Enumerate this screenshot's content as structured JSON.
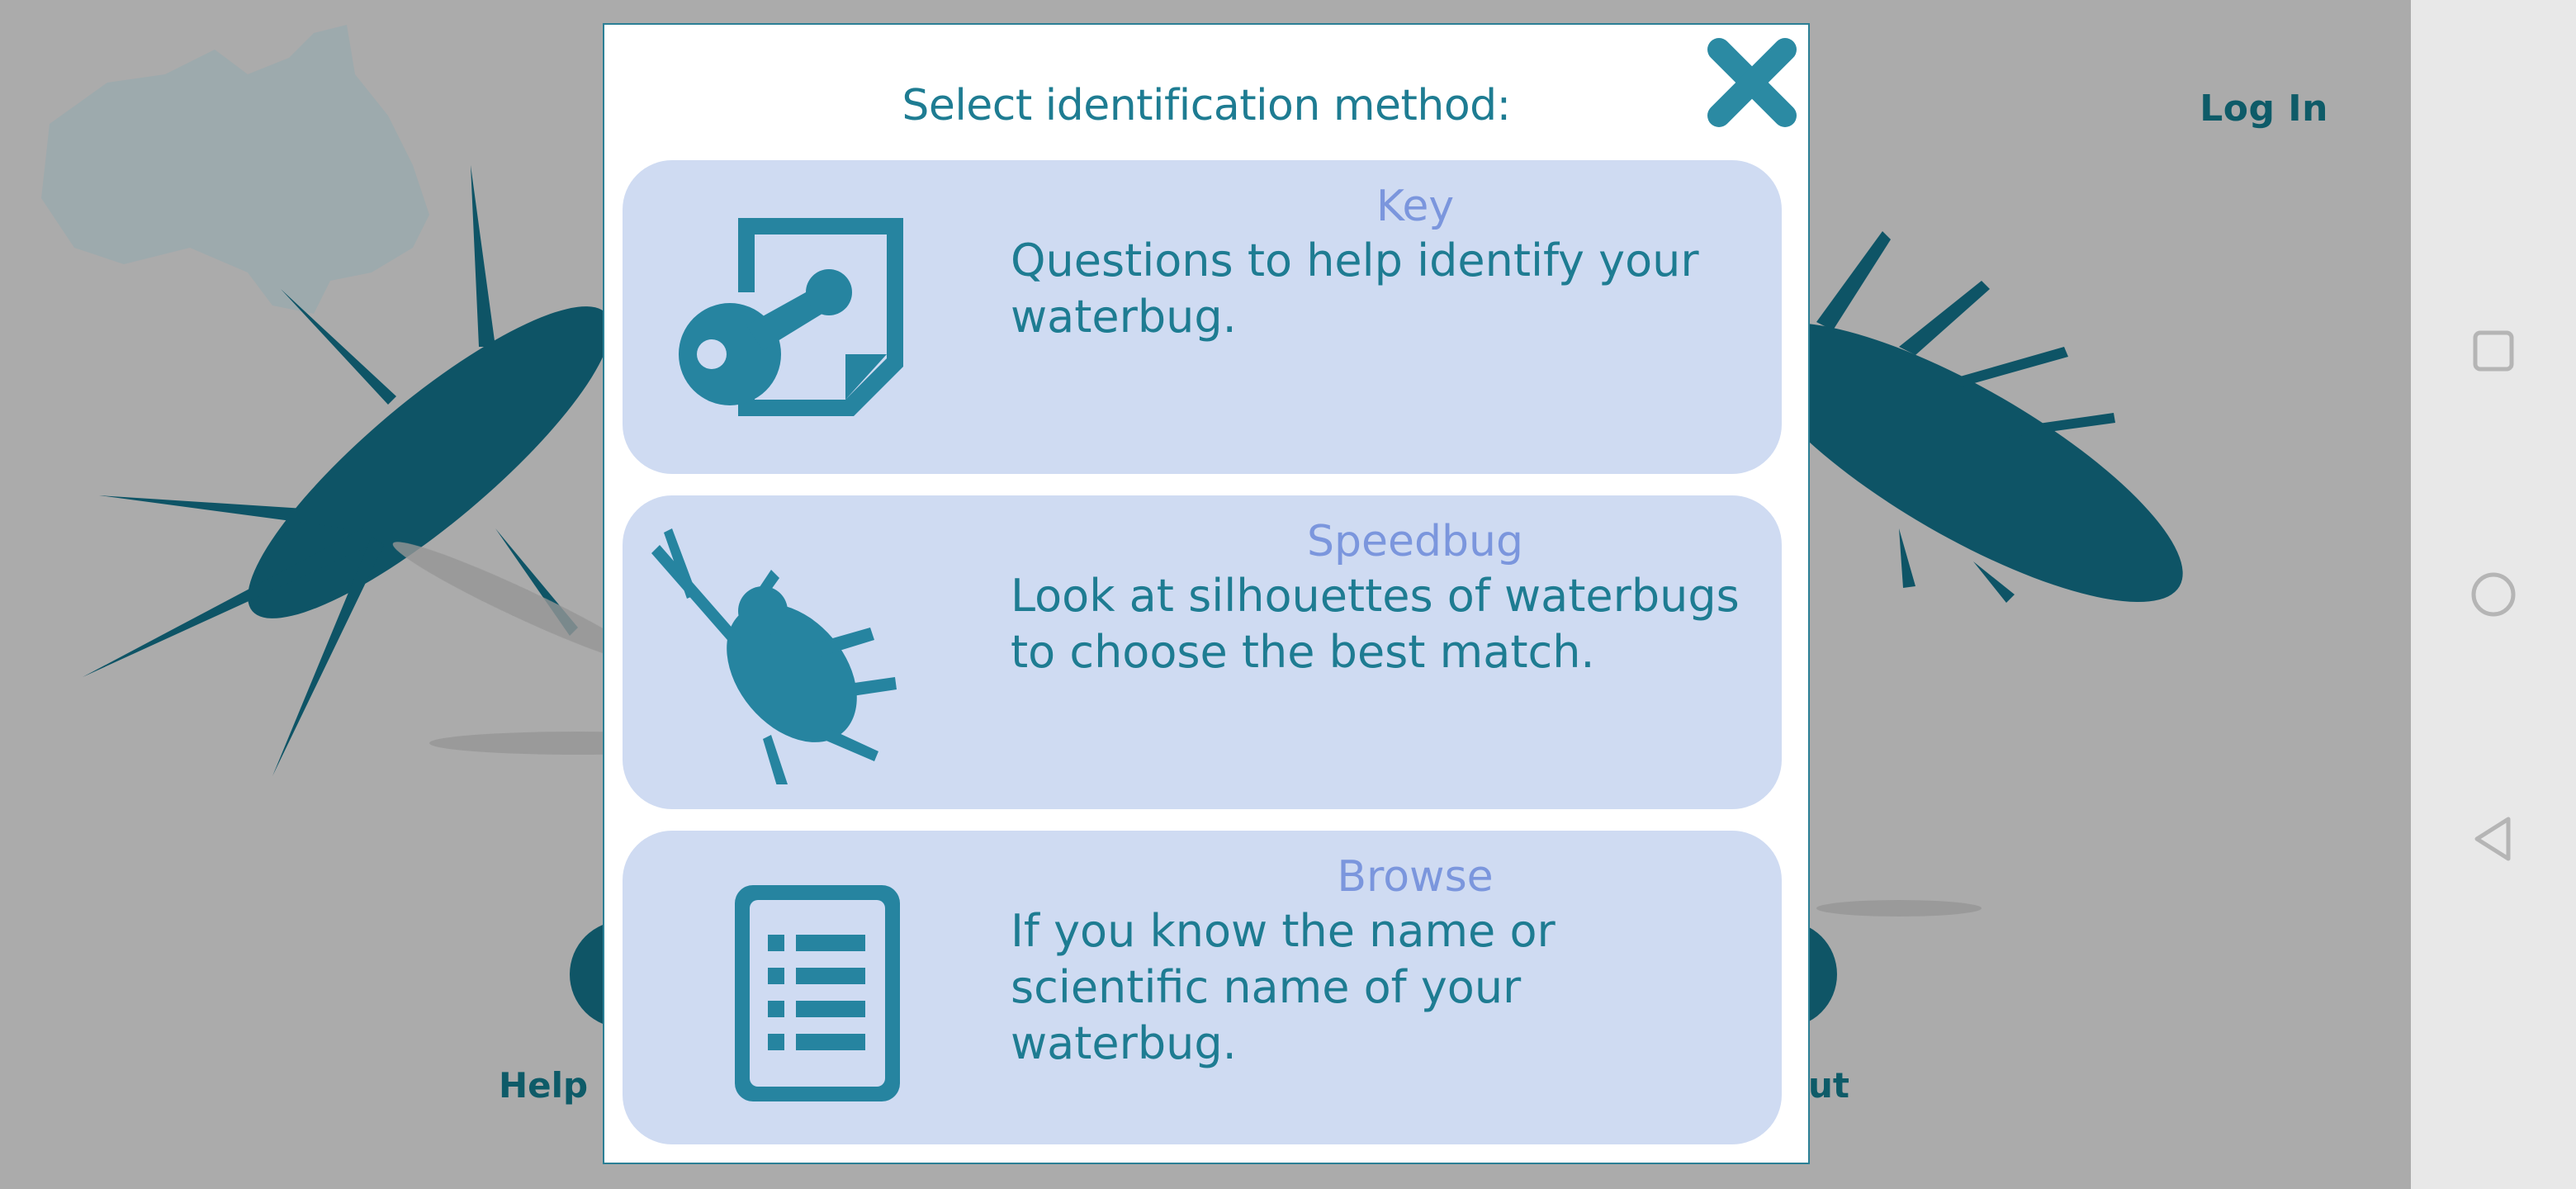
{
  "header": {
    "login_label": "Log In"
  },
  "background_nav": {
    "left_label_fragment": "Help",
    "right_label_fragment": "ut"
  },
  "dialog": {
    "title": "Select identification method:",
    "close_icon": "close-icon",
    "options": [
      {
        "title": "Key",
        "description": "Questions to help identify your waterbug.",
        "icon": "key-document-icon"
      },
      {
        "title": "Speedbug",
        "description": "Look at silhouettes of waterbugs to choose the best match.",
        "icon": "waterbug-silhouette-icon"
      },
      {
        "title": "Browse",
        "description": "If you know the name or scientific name of your waterbug.",
        "icon": "list-document-icon"
      }
    ]
  },
  "system_nav": {
    "recents_icon": "square-icon",
    "home_icon": "circle-icon",
    "back_icon": "triangle-back-icon"
  },
  "colors": {
    "accent": "#1e7c92",
    "option_bg": "#cfdbf2",
    "option_title": "#7b96dd",
    "dark_teal": "#0e5b68",
    "backdrop": "#ababab"
  }
}
